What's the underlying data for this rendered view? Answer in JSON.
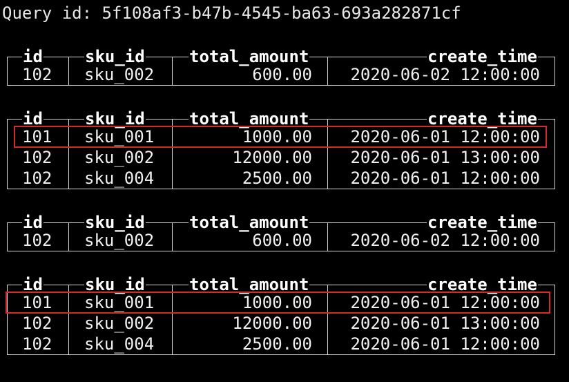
{
  "query": {
    "label": "Query id:",
    "id": "5f108af3-b47b-4545-ba63-693a282871cf"
  },
  "columns": [
    "id",
    "sku_id",
    "total_amount",
    "create_time"
  ],
  "tables": [
    {
      "rows": [
        [
          "102",
          "sku_002",
          "600.00",
          "2020-06-02 12:00:00"
        ]
      ],
      "highlight_row": null
    },
    {
      "rows": [
        [
          "101",
          "sku_001",
          "1000.00",
          "2020-06-01 12:00:00"
        ],
        [
          "102",
          "sku_002",
          "12000.00",
          "2020-06-01 13:00:00"
        ],
        [
          "102",
          "sku_004",
          "2500.00",
          "2020-06-01 12:00:00"
        ]
      ],
      "highlight_row": 0
    },
    {
      "rows": [
        [
          "102",
          "sku_002",
          "600.00",
          "2020-06-02 12:00:00"
        ]
      ],
      "highlight_row": null
    },
    {
      "rows": [
        [
          "101",
          "sku_001",
          "1000.00",
          "2020-06-01 12:00:00"
        ],
        [
          "102",
          "sku_002",
          "12000.00",
          "2020-06-01 13:00:00"
        ],
        [
          "102",
          "sku_004",
          "2500.00",
          "2020-06-01 12:00:00"
        ]
      ],
      "highlight_row": 0
    }
  ],
  "colors": {
    "background": "#000000",
    "text": "#f0f0f0",
    "border": "#d8d8d8",
    "highlight": "#d62a2a"
  }
}
